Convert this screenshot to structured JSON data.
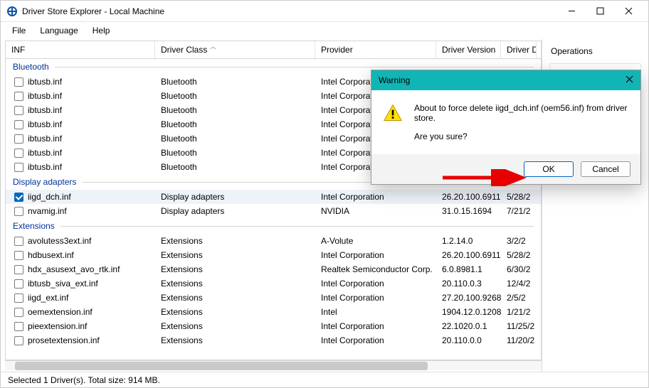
{
  "window": {
    "title": "Driver Store Explorer - Local Machine"
  },
  "menu": {
    "file": "File",
    "language": "Language",
    "help": "Help"
  },
  "columns": {
    "inf": "INF",
    "class": "Driver Class",
    "provider": "Provider",
    "version": "Driver Version",
    "date": "Driver D"
  },
  "groups": [
    {
      "name": "Bluetooth",
      "rows": [
        {
          "inf": "ibtusb.inf",
          "cls": "Bluetooth",
          "prov": "Intel Corporation",
          "ver": "",
          "date": ""
        },
        {
          "inf": "ibtusb.inf",
          "cls": "Bluetooth",
          "prov": "Intel Corporation",
          "ver": "",
          "date": ""
        },
        {
          "inf": "ibtusb.inf",
          "cls": "Bluetooth",
          "prov": "Intel Corporation",
          "ver": "",
          "date": ""
        },
        {
          "inf": "ibtusb.inf",
          "cls": "Bluetooth",
          "prov": "Intel Corporation",
          "ver": "",
          "date": ""
        },
        {
          "inf": "ibtusb.inf",
          "cls": "Bluetooth",
          "prov": "Intel Corporation",
          "ver": "",
          "date": ""
        },
        {
          "inf": "ibtusb.inf",
          "cls": "Bluetooth",
          "prov": "Intel Corporation",
          "ver": "",
          "date": ""
        },
        {
          "inf": "ibtusb.inf",
          "cls": "Bluetooth",
          "prov": "Intel Corporation",
          "ver": "",
          "date": ""
        }
      ]
    },
    {
      "name": "Display adapters",
      "rows": [
        {
          "inf": "iigd_dch.inf",
          "cls": "Display adapters",
          "prov": "Intel Corporation",
          "ver": "26.20.100.6911",
          "date": "5/28/2",
          "checked": true,
          "selected": true
        },
        {
          "inf": "nvamig.inf",
          "cls": "Display adapters",
          "prov": "NVIDIA",
          "ver": "31.0.15.1694",
          "date": "7/21/2"
        }
      ]
    },
    {
      "name": "Extensions",
      "rows": [
        {
          "inf": "avolutess3ext.inf",
          "cls": "Extensions",
          "prov": "A-Volute",
          "ver": "1.2.14.0",
          "date": "3/2/2"
        },
        {
          "inf": "hdbusext.inf",
          "cls": "Extensions",
          "prov": "Intel Corporation",
          "ver": "26.20.100.6911",
          "date": "5/28/2"
        },
        {
          "inf": "hdx_asusext_avo_rtk.inf",
          "cls": "Extensions",
          "prov": "Realtek Semiconductor Corp.",
          "ver": "6.0.8981.1",
          "date": "6/30/2"
        },
        {
          "inf": "ibtusb_siva_ext.inf",
          "cls": "Extensions",
          "prov": "Intel Corporation",
          "ver": "20.110.0.3",
          "date": "12/4/2"
        },
        {
          "inf": "iigd_ext.inf",
          "cls": "Extensions",
          "prov": "Intel Corporation",
          "ver": "27.20.100.9268",
          "date": "2/5/2"
        },
        {
          "inf": "oemextension.inf",
          "cls": "Extensions",
          "prov": "Intel",
          "ver": "1904.12.0.1208",
          "date": "1/21/2"
        },
        {
          "inf": "pieextension.inf",
          "cls": "Extensions",
          "prov": "Intel Corporation",
          "ver": "22.1020.0.1",
          "date": "11/25/2"
        },
        {
          "inf": "prosetextension.inf",
          "cls": "Extensions",
          "prov": "Intel Corporation",
          "ver": "20.110.0.0",
          "date": "11/20/2"
        }
      ]
    }
  ],
  "sidebar": {
    "operations": "Operations"
  },
  "status": "Selected 1 Driver(s). Total size: 914 MB.",
  "dialog": {
    "title": "Warning",
    "line1": "About to force delete iigd_dch.inf (oem56.inf) from driver store.",
    "line2": "Are you sure?",
    "ok": "OK",
    "cancel": "Cancel"
  }
}
